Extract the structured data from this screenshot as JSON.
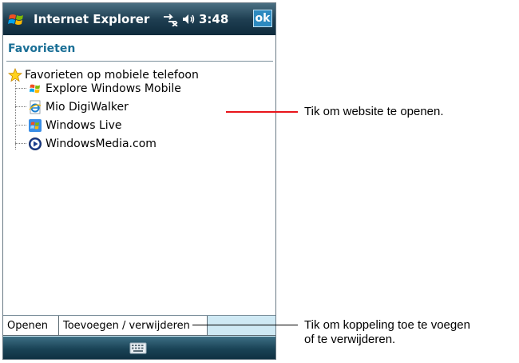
{
  "titlebar": {
    "app_title": "Internet Explorer",
    "clock": "3:48",
    "ok_label": "ok",
    "icons": [
      "windows-start-icon",
      "connectivity-icon",
      "volume-icon"
    ]
  },
  "page": {
    "title": "Favorieten"
  },
  "tree": {
    "root": {
      "label": "Favorieten op mobiele telefoon",
      "icon": "favorites-star-icon"
    },
    "items": [
      {
        "label": "Explore Windows Mobile",
        "icon": "windows-flag-icon"
      },
      {
        "label": "Mio DigiWalker",
        "icon": "ie-page-icon"
      },
      {
        "label": "Windows Live",
        "icon": "windows-live-icon"
      },
      {
        "label": "WindowsMedia.com",
        "icon": "windows-media-icon"
      }
    ]
  },
  "tabs": [
    {
      "label": "Openen"
    },
    {
      "label": "Toevoegen / verwijderen"
    }
  ],
  "menubar": {
    "icon": "keyboard-icon"
  },
  "callouts": [
    {
      "text": "Tik om website te openen."
    },
    {
      "text": "Tik om koppeling toe te voegen",
      "text2": "of te verwijderen."
    }
  ],
  "colors": {
    "title_accent": "#1a6f96",
    "callout_line": "#e8151b",
    "tab_background": "#cfe9f4"
  }
}
